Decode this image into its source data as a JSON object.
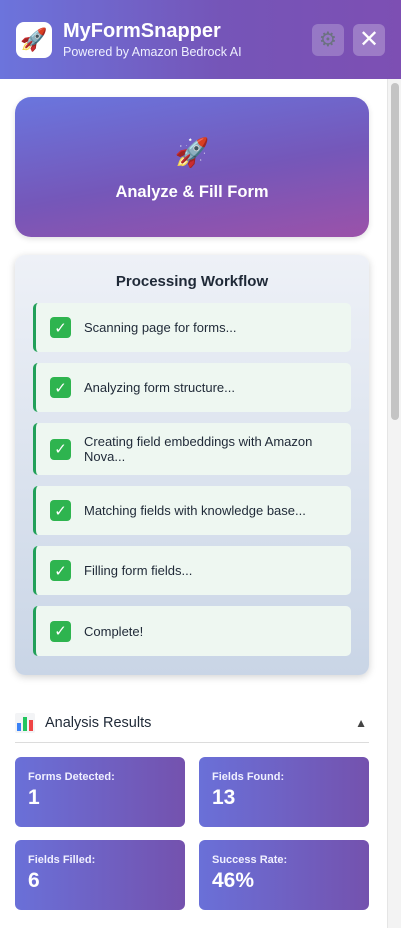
{
  "header": {
    "title": "MyFormSnapper",
    "subtitle": "Powered by Amazon Bedrock AI",
    "logo_icon": "rocket",
    "settings_icon": "gear",
    "close_icon": "close",
    "gradient_start": "#6c74dc",
    "gradient_end": "#7d4fb3"
  },
  "analyze_button": {
    "icon": "rocket",
    "label": "Analyze & Fill Form"
  },
  "workflow": {
    "title": "Processing Workflow",
    "steps": [
      {
        "status": "done",
        "label": "Scanning page for forms..."
      },
      {
        "status": "done",
        "label": "Analyzing form structure..."
      },
      {
        "status": "done",
        "label": "Creating field embeddings with Amazon Nova..."
      },
      {
        "status": "done",
        "label": "Matching fields with knowledge base..."
      },
      {
        "status": "done",
        "label": "Filling form fields..."
      },
      {
        "status": "done",
        "label": "Complete!"
      }
    ],
    "accent_color": "#22a05a"
  },
  "results": {
    "icon": "bar-chart",
    "title": "Analysis Results",
    "toggle_icon": "triangle-up",
    "stats": [
      {
        "label": "Forms Detected:",
        "value": "1"
      },
      {
        "label": "Fields Found:",
        "value": "13"
      },
      {
        "label": "Fields Filled:",
        "value": "6"
      },
      {
        "label": "Success Rate:",
        "value": "46%"
      }
    ]
  }
}
